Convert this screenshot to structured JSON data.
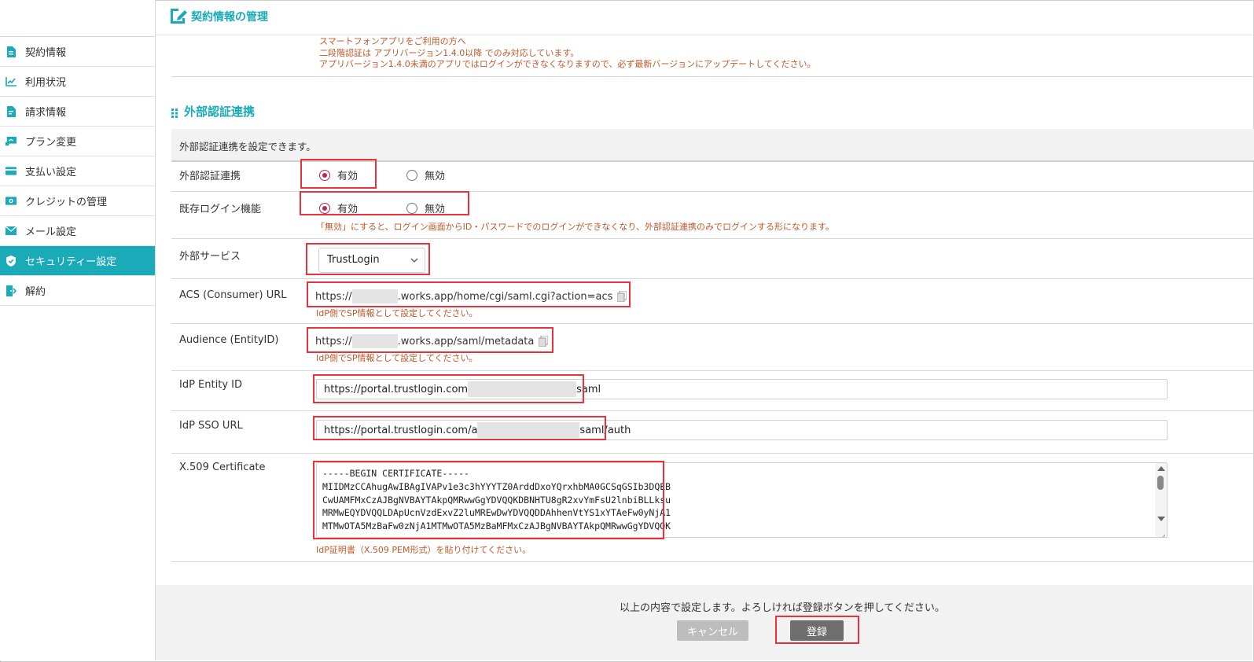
{
  "header": {
    "title": "契約情報の管理",
    "icon": "contract-edit-icon"
  },
  "sidebar": {
    "items": [
      {
        "label": "契約情報",
        "icon": "document-icon",
        "active": false
      },
      {
        "label": "利用状況",
        "icon": "line-chart-icon",
        "active": false
      },
      {
        "label": "請求情報",
        "icon": "invoice-icon",
        "active": false
      },
      {
        "label": "プラン変更",
        "icon": "plan-icon",
        "active": false
      },
      {
        "label": "支払い設定",
        "icon": "credit-card-icon",
        "active": false
      },
      {
        "label": "クレジットの管理",
        "icon": "money-icon",
        "active": false
      },
      {
        "label": "メール設定",
        "icon": "mail-icon",
        "active": false
      },
      {
        "label": "セキュリティー設定",
        "icon": "shield-icon",
        "active": true
      },
      {
        "label": "解約",
        "icon": "exit-door-icon",
        "active": false
      }
    ]
  },
  "notice": {
    "line1": "スマートフォンアプリをご利用の方へ",
    "line2": "二段階認証は アプリバージョン1.4.0以降 でのみ対応しています。",
    "line3": "アプリバージョン1.4.0未満のアプリではログインができなくなりますので、必ず最新バージョンにアップデートしてください。"
  },
  "section": {
    "title": "外部認証連携",
    "description": "外部認証連携を設定できます。"
  },
  "form": {
    "external_auth": {
      "label": "外部認証連携",
      "on_label": "有効",
      "off_label": "無効",
      "selected": "on"
    },
    "legacy_login": {
      "label": "既存ログイン機能",
      "on_label": "有効",
      "off_label": "無効",
      "selected": "on",
      "hint": "「無効」にすると、ログイン画面からID・パスワードでのログインができなくなり、外部認証連携のみでログインする形になります。"
    },
    "service": {
      "label": "外部サービス",
      "value": "TrustLogin"
    },
    "acs": {
      "label": "ACS (Consumer) URL",
      "prefix": "https://",
      "suffix": ".works.app/home/cgi/saml.cgi?action=acs",
      "hint": "IdP側でSP情報として設定してください。"
    },
    "audience": {
      "label": "Audience (EntityID)",
      "prefix": "https://",
      "suffix": ".works.app/saml/metadata",
      "hint": "IdP側でSP情報として設定してください。"
    },
    "idp_entity": {
      "label": "IdP Entity ID",
      "prefix": "https://portal.trustlogin.com",
      "suffix": "saml"
    },
    "idp_sso": {
      "label": "IdP SSO URL",
      "prefix": "https://portal.trustlogin.com/a",
      "suffix": "saml/auth"
    },
    "certificate": {
      "label": "X.509 Certificate",
      "lines": [
        "-----BEGIN CERTIFICATE-----",
        "MIIDMzCCAhugAwIBAgIVAPv1e3c3hYYYTZ0ArddDxoYQrxhbMA0GCSqGSIb3DQEB",
        "CwUAMFMxCzAJBgNVBAYTAkpQMRwwGgYDVQQKDBNHTU8gR2xvYmFsU2lnbiBLLksu",
        "MRMwEQYDVQQLDApUcnVzdExvZ2luMREwDwYDVQQDDAhhenVtYS1xYTAeFw0yNjA1",
        "MTMwOTA5MzBaFw0zNjA1MTMwOTA5MzBaMFMxCzAJBgNVBAYTAkpQMRwwGgYDVQQK"
      ],
      "hint": "IdP証明書（X.509 PEM形式）を貼り付けてください。"
    }
  },
  "footer": {
    "message": "以上の内容で設定します。よろしければ登録ボタンを押してください。",
    "cancel_label": "キャンセル",
    "submit_label": "登録"
  },
  "colors": {
    "accent": "#1aaab8",
    "notice": "#c0582a",
    "radio": "#b12d4b",
    "highlight": "#e8333d"
  }
}
